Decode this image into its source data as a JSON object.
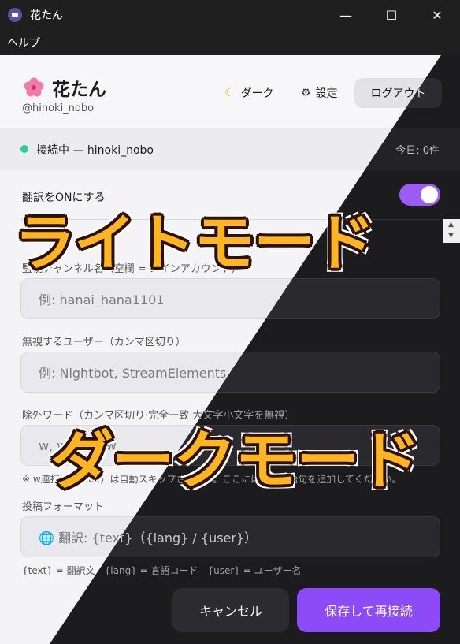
{
  "window": {
    "title": "花たん",
    "minimize": "—",
    "maximize": "☐",
    "close": "✕"
  },
  "menu": {
    "help": "ヘルプ"
  },
  "header": {
    "app_name": "花たん",
    "handle": "@hinoki_nobo",
    "dark_label": "ダーク",
    "settings_label": "設定",
    "logout_label": "ログアウト"
  },
  "status": {
    "text": "接続中 — hinoki_nobo",
    "today": "今日: 0件",
    "dot_color": "#2ecc9a"
  },
  "translate": {
    "label": "翻訳をONにする",
    "on": true
  },
  "fields": {
    "channel": {
      "label": "監視チャンネル名（空欄 = メインアカウント）",
      "placeholder": "例: hanai_hana1101"
    },
    "ignore_users": {
      "label": "無視するユーザー（カンマ区切り）",
      "placeholder": "例: Nightbot, StreamElements"
    },
    "exclude_words": {
      "label": "除外ワード（カンマ区切り·完全一致·大文字小文字を無視）",
      "value": "w, ww, www",
      "hint": "※ w連打（www...）は自動スキップされます。ここには特定の語句を追加してください。"
    },
    "format": {
      "label": "投稿フォーマット",
      "value": "🌐 翻訳: {text}（{lang} / {user}）",
      "hint": "{text} = 翻訳文　{lang} = 言語コード　{user} = ユーザー名"
    }
  },
  "actions": {
    "cancel": "キャンセル",
    "save": "保存して再接続"
  },
  "overlay": {
    "light": "ライトモード",
    "dark": "ダークモード"
  },
  "colors": {
    "accent": "#8c4bf6",
    "caption": "#ffb422"
  }
}
